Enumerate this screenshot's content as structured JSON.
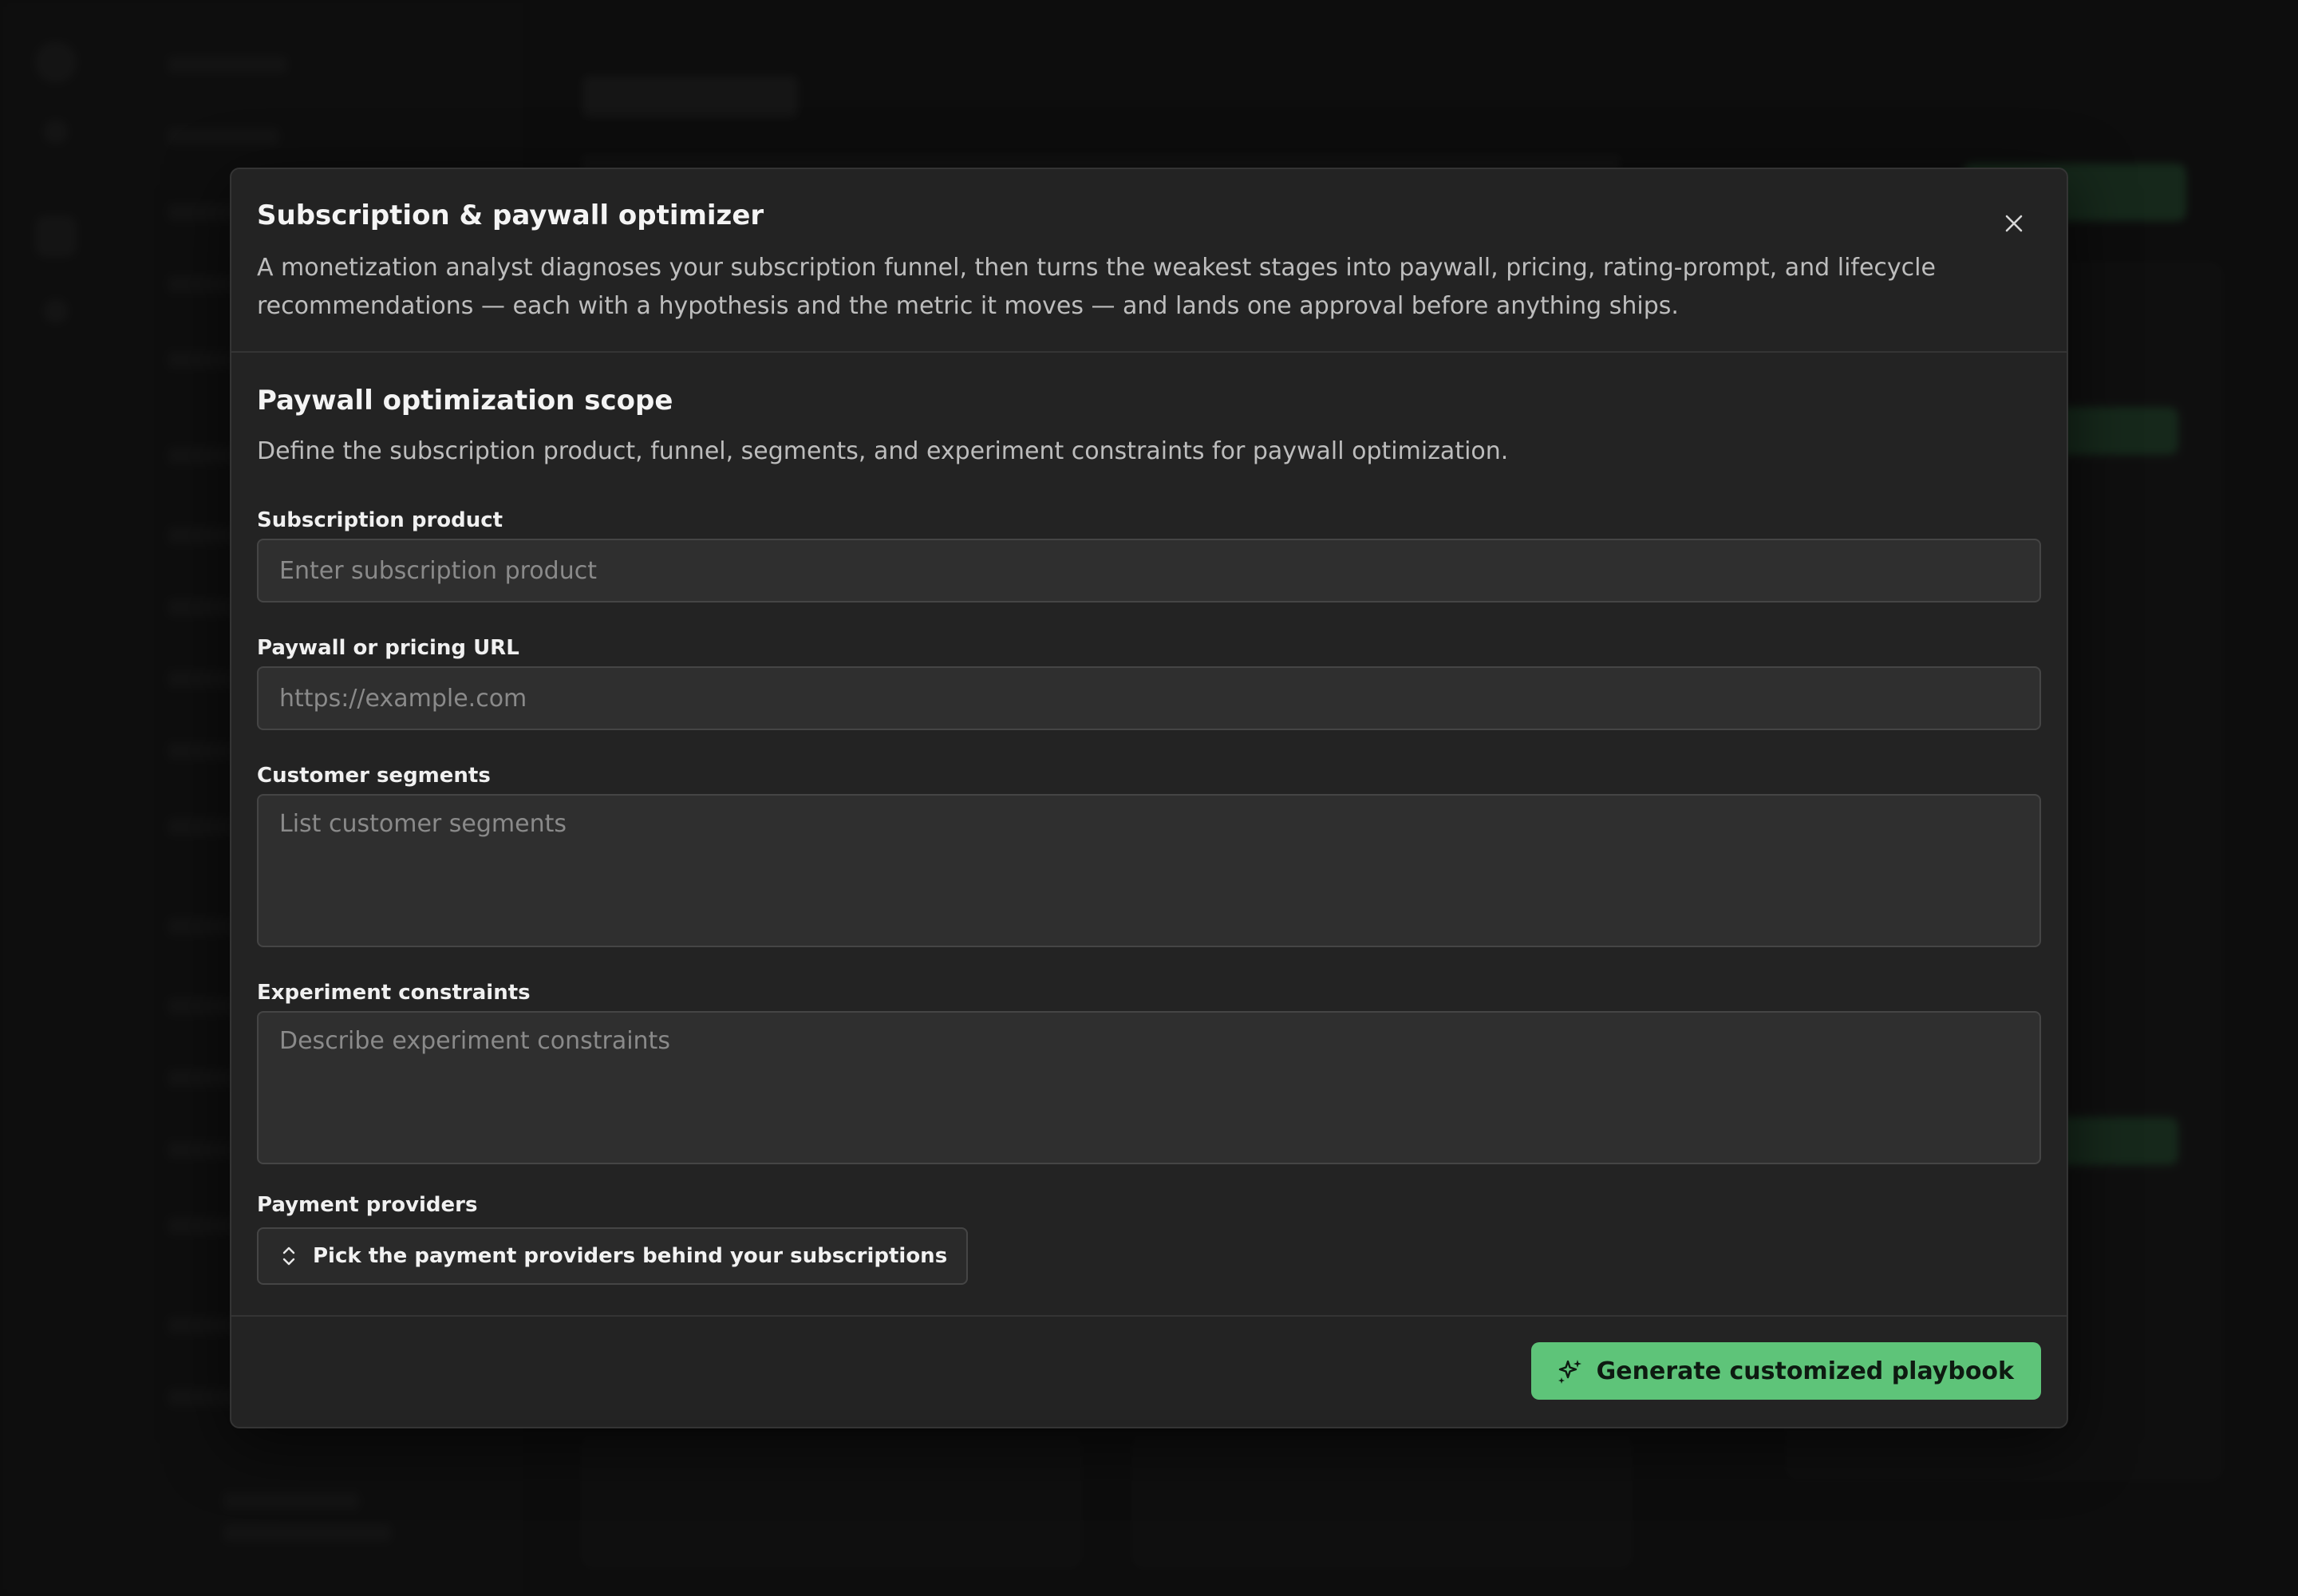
{
  "modal": {
    "title": "Subscription & paywall optimizer",
    "description": "A monetization analyst diagnoses your subscription funnel, then turns the weakest stages into paywall, pricing, rating-prompt, and lifecycle recommendations — each with a hypothesis and the metric it moves — and lands one approval before anything ships.",
    "close_icon": "close-icon"
  },
  "scope": {
    "title": "Paywall optimization scope",
    "description": "Define the subscription product, funnel, segments, and experiment constraints for paywall optimization."
  },
  "fields": {
    "subscription_product": {
      "label": "Subscription product",
      "placeholder": "Enter subscription product",
      "value": ""
    },
    "paywall_url": {
      "label": "Paywall or pricing URL",
      "placeholder": "https://example.com",
      "value": ""
    },
    "customer_segments": {
      "label": "Customer segments",
      "placeholder": "List customer segments",
      "value": ""
    },
    "experiment_constraints": {
      "label": "Experiment constraints",
      "placeholder": "Describe experiment constraints",
      "value": ""
    },
    "payment_providers": {
      "label": "Payment providers",
      "button_label": "Pick the payment providers behind your subscriptions",
      "icon": "chevron-up-down-icon"
    }
  },
  "footer": {
    "generate_label": "Generate customized playbook",
    "generate_icon": "sparkles-icon"
  },
  "colors": {
    "accent": "#5ec479",
    "modal_bg": "#232323",
    "field_bg": "#2f2f2f",
    "backdrop": "#111111"
  }
}
